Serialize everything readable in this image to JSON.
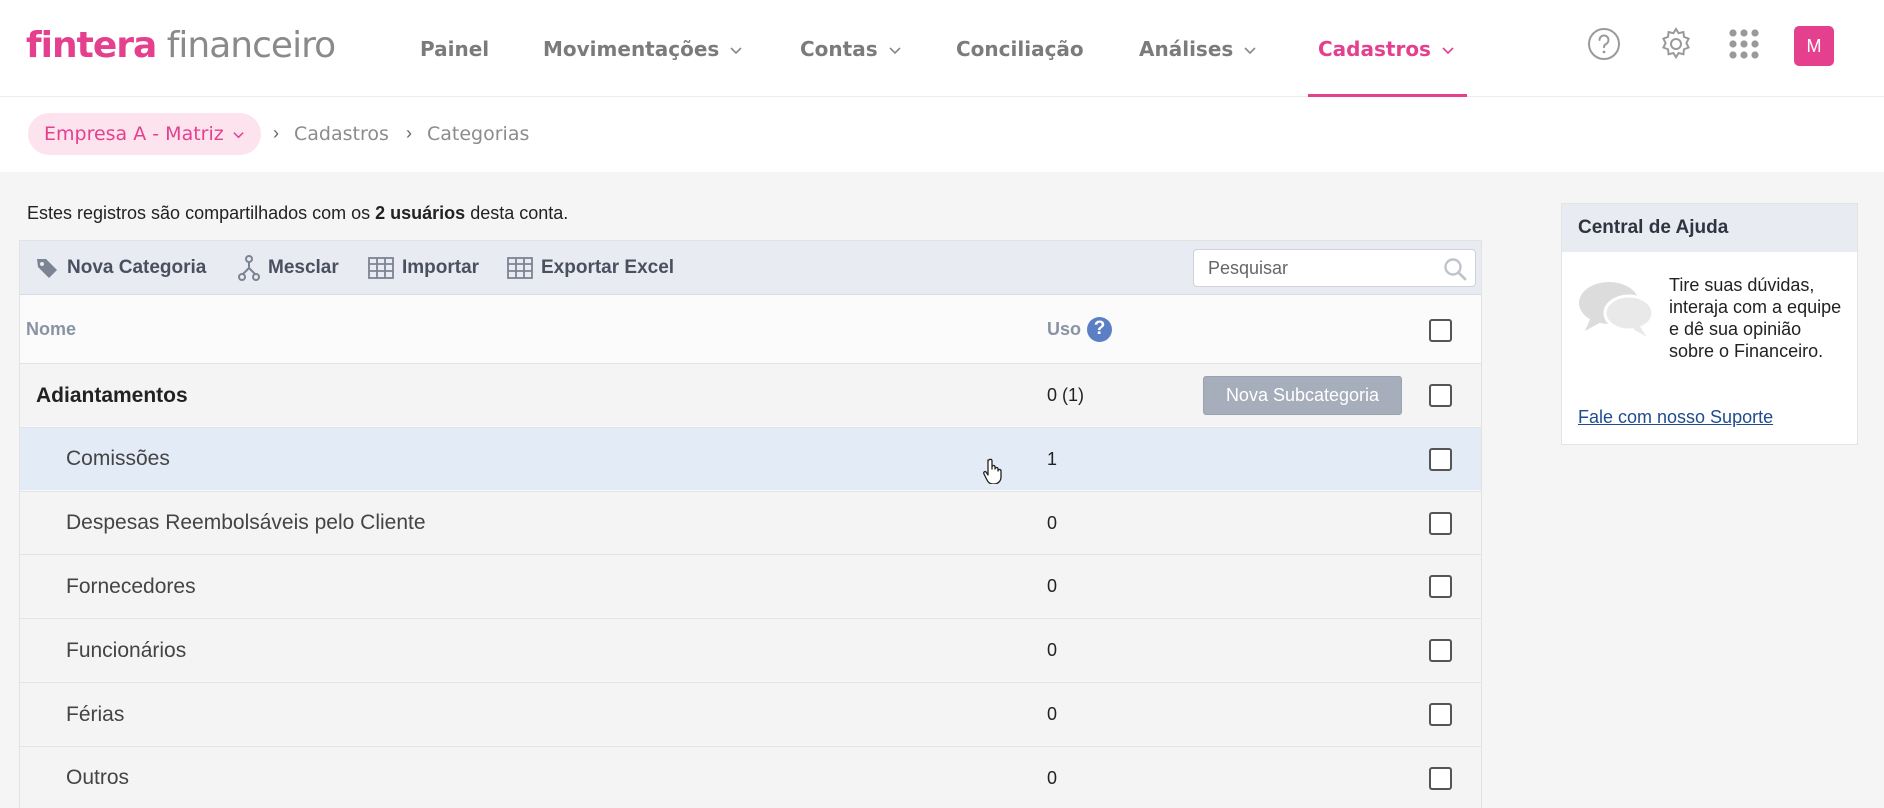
{
  "logo": {
    "brand": "fintera",
    "product": " financeiro"
  },
  "nav": {
    "items": [
      {
        "label": "Painel"
      },
      {
        "label": "Movimentações"
      },
      {
        "label": "Contas"
      },
      {
        "label": "Conciliação"
      },
      {
        "label": "Análises"
      },
      {
        "label": "Cadastros"
      }
    ],
    "active": "Cadastros"
  },
  "user": {
    "initial": "M"
  },
  "breadcrumb": {
    "company": "Empresa A - Matriz",
    "items": [
      "Cadastros",
      "Categorias"
    ]
  },
  "shared_note": {
    "prefix": "Estes registros são compartilhados com os ",
    "bold": "2 usuários",
    "suffix": " desta conta."
  },
  "toolbar": {
    "new_category": "Nova Categoria",
    "merge": "Mesclar",
    "import": "Importar",
    "export": "Exportar Excel",
    "search_placeholder": "Pesquisar"
  },
  "table": {
    "columns": {
      "name": "Nome",
      "usage": "Uso",
      "usage_help": "?"
    },
    "new_subcategory": "Nova Subcategoria",
    "rows": [
      {
        "name": "Adiantamentos",
        "usage": "0 (1)",
        "parent": true
      },
      {
        "name": "Comissões",
        "usage": "1",
        "parent": false,
        "hover": true
      },
      {
        "name": "Despesas Reembolsáveis pelo Cliente",
        "usage": "0",
        "parent": false
      },
      {
        "name": "Fornecedores",
        "usage": "0",
        "parent": false
      },
      {
        "name": "Funcionários",
        "usage": "0",
        "parent": false
      },
      {
        "name": "Férias",
        "usage": "0",
        "parent": false
      },
      {
        "name": "Outros",
        "usage": "0",
        "parent": false
      }
    ]
  },
  "help_center": {
    "title": "Central de Ajuda",
    "text": "Tire suas dúvidas, interaja com a equipe e dê sua opinião sobre o Financeiro.",
    "link": "Fale com nosso Suporte"
  },
  "colors": {
    "brand_pink": "#e4408e",
    "toolbar_bg": "#e8ebf1",
    "hover_row": "#e2ebf6",
    "help_icon": "#5b7fc4"
  },
  "icons": [
    "chevron-down-icon",
    "question-icon",
    "gear-icon",
    "apps-grid-icon",
    "tag-icon",
    "merge-icon",
    "table-icon",
    "search-icon",
    "chat-bubbles-icon",
    "hand-cursor-icon"
  ]
}
